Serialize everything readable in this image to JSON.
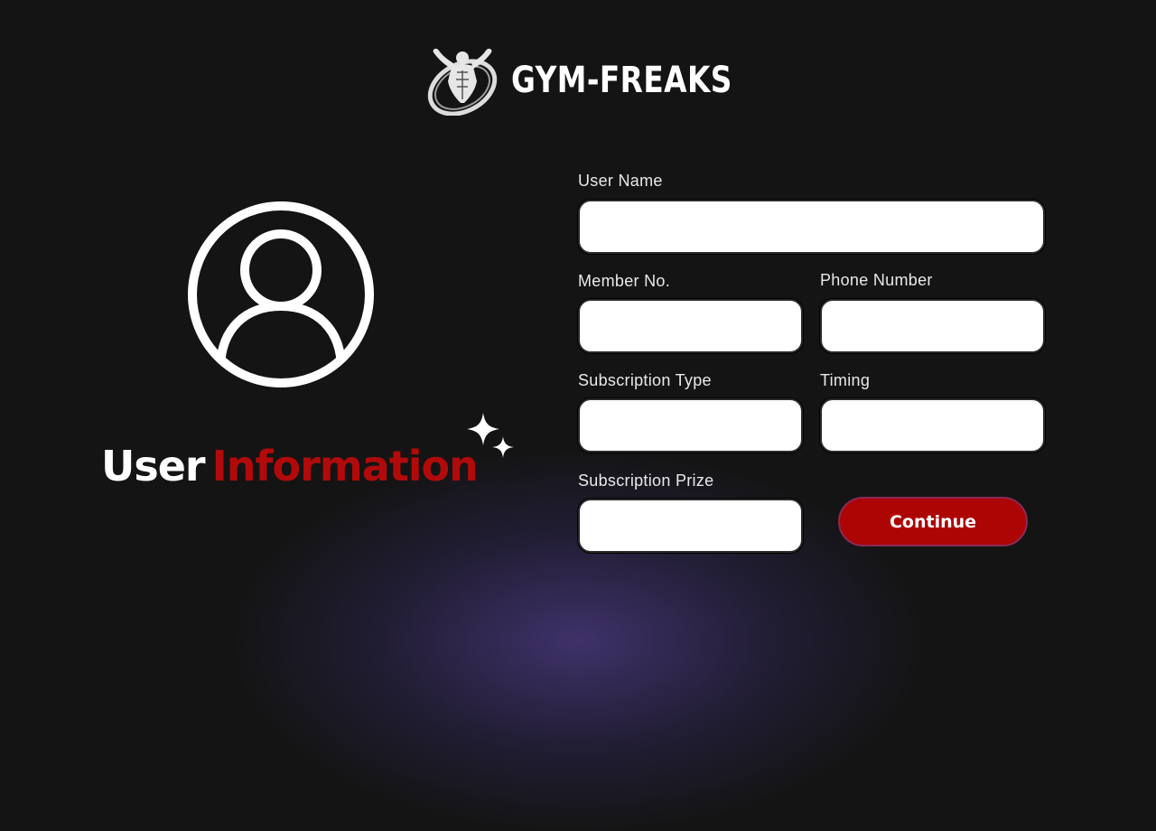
{
  "brand": {
    "name": "GYM-FREAKS",
    "logo_icon": "bodybuilder-logo-icon"
  },
  "hero": {
    "title_part1": "User",
    "title_part2": "Information",
    "avatar_icon": "user-profile-icon",
    "sparkle_icon": "sparkle-icon"
  },
  "form": {
    "user_name": {
      "label": "User Name",
      "value": "",
      "placeholder": ""
    },
    "member_no": {
      "label": "Member No.",
      "value": "",
      "placeholder": ""
    },
    "phone_number": {
      "label": "Phone Number",
      "value": "",
      "placeholder": ""
    },
    "subscription_type": {
      "label": "Subscription Type",
      "value": "",
      "placeholder": ""
    },
    "timing": {
      "label": "Timing",
      "value": "",
      "placeholder": ""
    },
    "subscription_prize": {
      "label": "Subscription Prize",
      "value": "",
      "placeholder": ""
    },
    "continue_label": "Continue"
  },
  "colors": {
    "background": "#141414",
    "accent_red": "#b20a0a",
    "button_red": "#ad0404",
    "glow_purple": "#463778",
    "text": "#ffffff"
  }
}
